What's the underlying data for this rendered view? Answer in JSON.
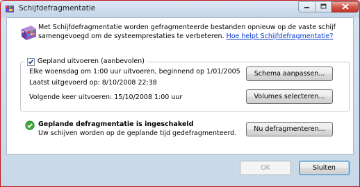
{
  "window": {
    "title": "Schijfdefragmentatie",
    "icon": "defrag-app-icon",
    "controls": {
      "minimize": "minimize-icon",
      "maximize": "maximize-icon",
      "close": "close-icon"
    }
  },
  "intro": {
    "text": "Met Schijfdefragmentatie worden gefragmenteerde bestanden opnieuw op de vaste schijf samengevoegd om de systeemprestaties te verbeteren.",
    "link": "Hoe helpt Schijfdefragmentatie?"
  },
  "schedule": {
    "checkbox_label": "Gepland uitvoeren (aanbevolen)",
    "checked": true,
    "lines": [
      "Elke woensdag om 1:00 uur uitvoeren, beginnend op 1/01/2005",
      "Laatst uitgevoerd op: 8/10/2008 22:38",
      "Volgende keer uitvoeren: 15/10/2008 1:00 uur"
    ],
    "modify_button": "Schema aanpassen...",
    "volumes_button": "Volumes selecteren..."
  },
  "status": {
    "icon": "check-shield-icon",
    "title": "Geplande defragmentatie is ingeschakeld",
    "description": "Uw schijven worden op de geplande tijd gedefragmenteerd.",
    "defrag_button": "Nu defragmenteren..."
  },
  "footer": {
    "ok": "OK",
    "close": "Sluiten"
  },
  "colors": {
    "accent_link": "#0033cc",
    "window_frame": "#c9d8e8",
    "close_button": "#c2372a"
  }
}
